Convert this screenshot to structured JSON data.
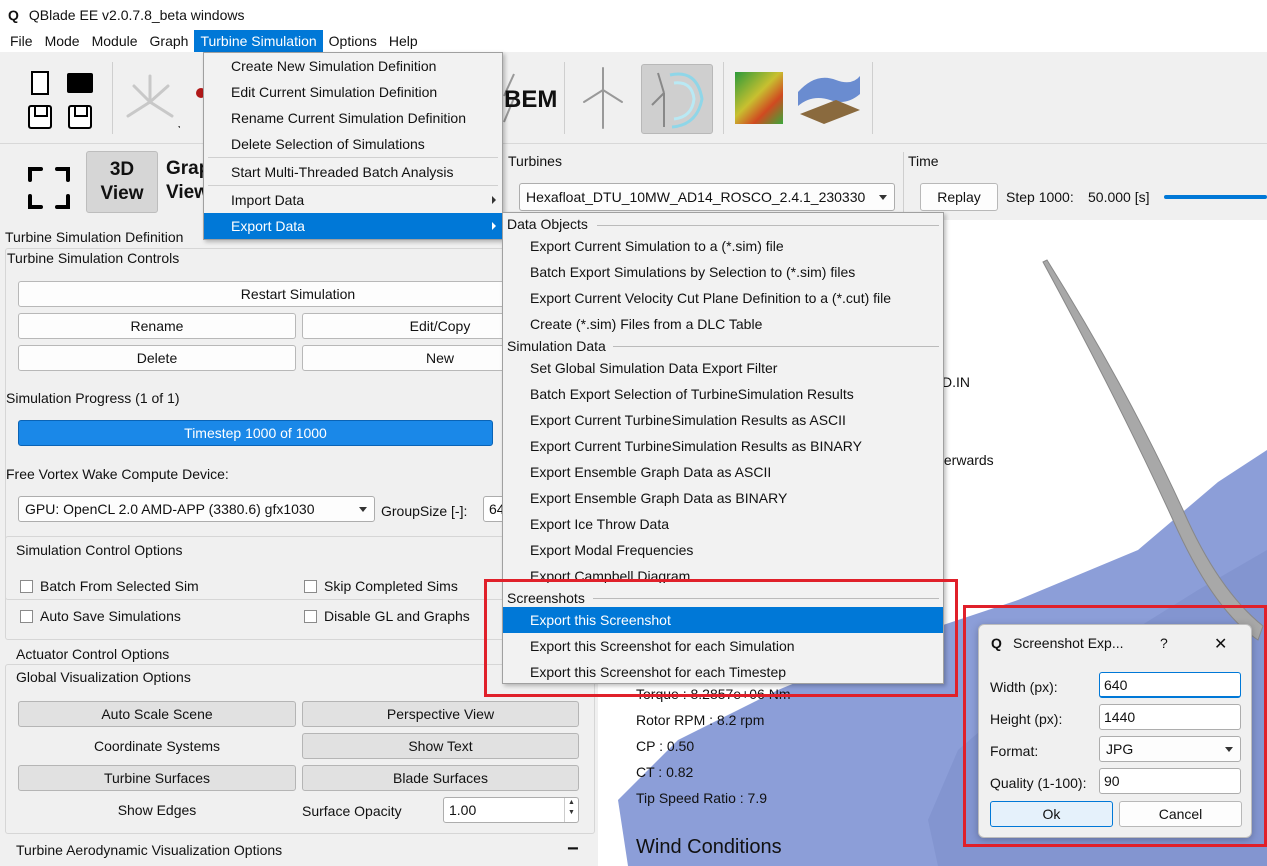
{
  "window": {
    "title": "QBlade EE v2.0.7.8_beta windows",
    "logo": "Q"
  },
  "menubar": [
    "File",
    "Mode",
    "Module",
    "Graph",
    "Turbine Simulation",
    "Options",
    "Help"
  ],
  "toolbar": {
    "bem_label": "BEM"
  },
  "view_buttons": {
    "view3d_line1": "3D",
    "view3d_line2": "View",
    "graph_line1": "Grap",
    "graph_line2": "View"
  },
  "turbines": {
    "label": "Turbines",
    "selected": "Hexafloat_DTU_10MW_AD14_ROSCO_2.4.1_230330"
  },
  "time": {
    "label": "Time",
    "replay": "Replay",
    "step_label": "Step 1000:",
    "step_value": "50.000 [s]"
  },
  "left_panel": {
    "header": "Turbine Simulation Definition",
    "controls_title": "Turbine Simulation Controls",
    "restart": "Restart Simulation",
    "rename": "Rename",
    "edit_copy": "Edit/Copy",
    "delete": "Delete",
    "new": "New",
    "progress_label": "Simulation Progress (1 of 1)",
    "progress_text": "Timestep 1000 of 1000",
    "progress_fraction": 1.0,
    "device_label": "Free Vortex Wake Compute Device:",
    "device_value": "GPU: OpenCL 2.0 AMD-APP (3380.6) gfx1030",
    "groupsize_label": "GroupSize [-]:",
    "groupsize_value": "64",
    "sim_control_title": "Simulation Control Options",
    "chk_batch": "Batch From Selected Sim",
    "chk_skip": "Skip Completed Sims",
    "chk_autosave": "Auto Save Simulations",
    "chk_disable_gl": "Disable GL and Graphs",
    "actuator_title": "Actuator Control Options",
    "global_vis_title": "Global Visualization Options",
    "auto_scale": "Auto Scale Scene",
    "perspective": "Perspective View",
    "coord_systems": "Coordinate Systems",
    "show_text": "Show Text",
    "turbine_surfaces": "Turbine Surfaces",
    "blade_surfaces": "Blade Surfaces",
    "show_edges": "Show Edges",
    "surface_opacity_label": "Surface Opacity",
    "surface_opacity_value": "1.00",
    "aero_vis_title": "Turbine Aerodynamic Visualization Options",
    "collapse": "−"
  },
  "viewport": {
    "frag_din": "D.IN",
    "frag_afterwards": "terwards",
    "torque_partial": "Torque : 8.2857e+06 Nm",
    "rotor_rpm": "Rotor RPM : 8.2 rpm",
    "cp": "CP : 0.50",
    "ct": "CT : 0.82",
    "tsr": "Tip Speed Ratio : 7.9",
    "wind_conditions": "Wind Conditions"
  },
  "turbine_menu": {
    "items": [
      "Create New Simulation Definition",
      "Edit Current Simulation Definition",
      "Rename Current Simulation Definition",
      "Delete Selection of Simulations",
      "Start Multi-Threaded Batch Analysis",
      "Import Data",
      "Export Data"
    ]
  },
  "export_menu": {
    "data_objects_header": "Data Objects",
    "data_objects": [
      "Export Current Simulation to a (*.sim) file",
      "Batch Export Simulations by Selection to (*.sim) files",
      "Export Current Velocity Cut Plane Definition to a (*.cut) file",
      "Create (*.sim) Files from a DLC Table"
    ],
    "simulation_data_header": "Simulation Data",
    "simulation_data": [
      "Set Global Simulation Data Export Filter",
      "Batch Export Selection of TurbineSimulation Results",
      "Export Current TurbineSimulation Results as ASCII",
      "Export Current TurbineSimulation Results as BINARY",
      "Export Ensemble Graph Data as ASCII",
      "Export Ensemble Graph Data as BINARY",
      "Export Ice Throw Data",
      "Export Modal Frequencies",
      "Export Campbell Diagram"
    ],
    "screenshots_header": "Screenshots",
    "screenshots": [
      "Export this Screenshot",
      "Export this Screenshot for each Simulation",
      "Export this Screenshot for each Timestep"
    ]
  },
  "dialog": {
    "title": "Screenshot Exp...",
    "help": "?",
    "close": "✕",
    "width_label": "Width (px):",
    "width_value": "640",
    "height_label": "Height (px):",
    "height_value": "1440",
    "format_label": "Format:",
    "format_value": "JPG",
    "quality_label": "Quality (1-100):",
    "quality_value": "90",
    "ok": "Ok",
    "cancel": "Cancel"
  },
  "colors": {
    "accent": "#0078d7",
    "highlight_box": "#e0202a",
    "progress": "#1a88e8"
  }
}
